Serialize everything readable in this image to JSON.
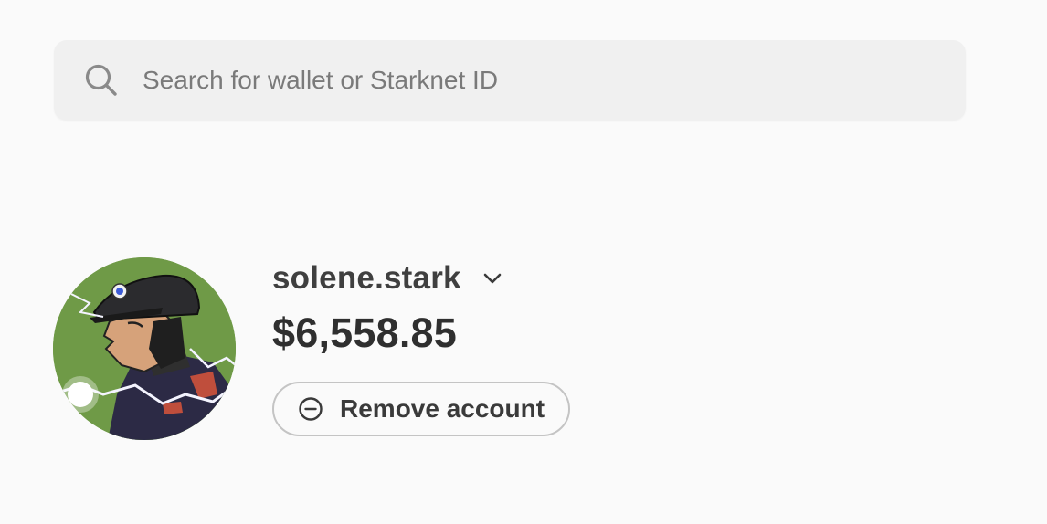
{
  "search": {
    "placeholder": "Search for wallet or Starknet ID",
    "value": "",
    "icon": "search-icon"
  },
  "account": {
    "name": "solene.stark",
    "balance": "$6,558.85",
    "avatar_icon": "avatar",
    "dropdown_icon": "chevron-down-icon",
    "remove_button": {
      "label": "Remove account",
      "icon": "minus-circle-icon"
    }
  },
  "colors": {
    "background": "#fafafa",
    "search_bg": "#f0f0f0",
    "avatar_bg": "#6f9a47",
    "text_primary": "#3a3a3a",
    "placeholder": "#7a7a7a",
    "button_border": "#c4c4c4"
  }
}
